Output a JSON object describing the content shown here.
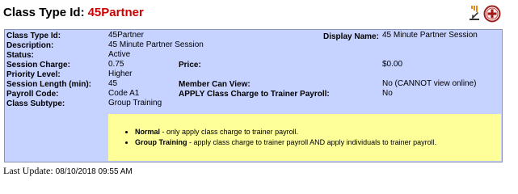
{
  "header": {
    "title_label": "Class Type Id:",
    "title_value": "45Partner",
    "accent_color": "#cc0000"
  },
  "icons": {
    "sort": "sort-icon",
    "add": "add-circle-icon"
  },
  "details": {
    "class_type_id": {
      "label": "Class Type Id:",
      "value": "45Partner"
    },
    "description": {
      "label": "Description:",
      "value": "45 Minute Partner Session"
    },
    "status": {
      "label": "Status:",
      "value": "Active"
    },
    "session_charge": {
      "label": "Session Charge:",
      "value": "0.75"
    },
    "priority_level": {
      "label": "Priority Level:",
      "value": "Higher"
    },
    "session_length": {
      "label": "Session Length (min):",
      "value": "45"
    },
    "payroll_code": {
      "label": "Payroll Code:",
      "value": "Code A1"
    },
    "class_subtype": {
      "label": "Class Subtype:",
      "value": "Group Training"
    },
    "display_name": {
      "label": "Display Name:",
      "value": "45 Minute Partner Session"
    },
    "price": {
      "label": "Price:",
      "value": "$0.00"
    },
    "member_can_view": {
      "label": "Member Can View:",
      "value": "No (CANNOT view online)"
    },
    "apply_class_charge": {
      "label": "APPLY Class Charge to Trainer Payroll:",
      "value": "No"
    }
  },
  "note": {
    "items": [
      {
        "term": "Normal",
        "text": " - only apply class charge to trainer payroll."
      },
      {
        "term": "Group Training",
        "text": " - apply class charge to trainer payroll AND apply individuals to trainer payroll."
      }
    ]
  },
  "footer": {
    "label": "Last Update:",
    "timestamp": "08/10/2018 09:55 AM"
  }
}
